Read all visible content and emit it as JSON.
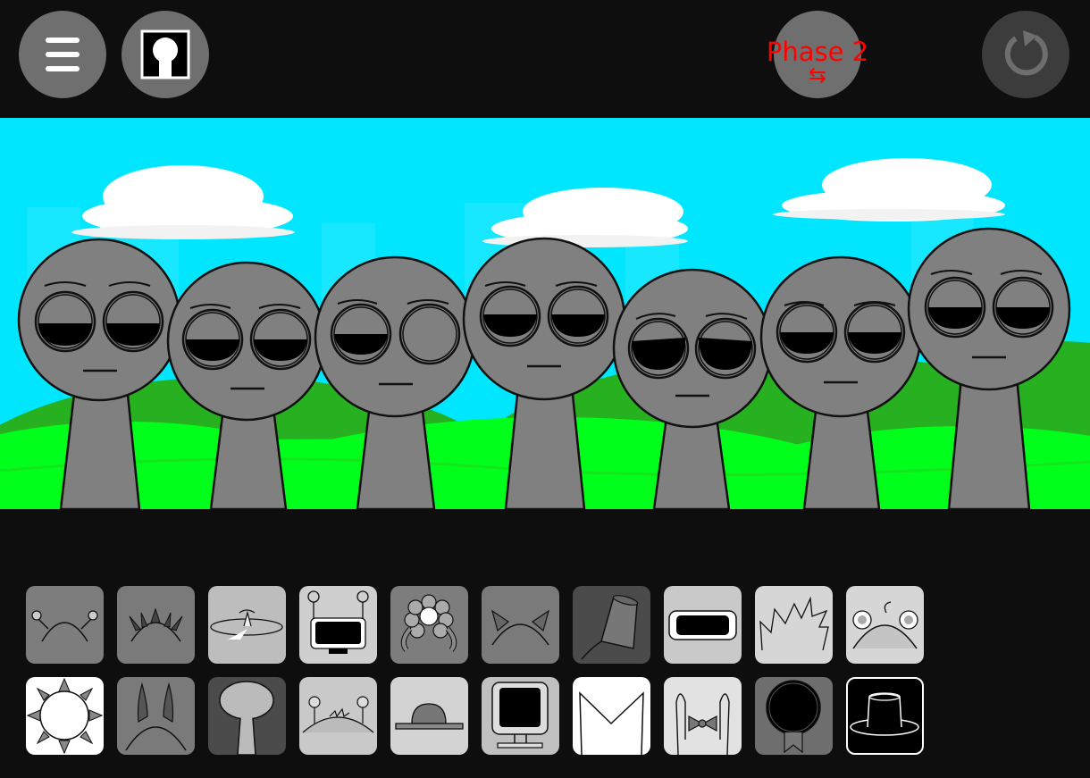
{
  "toolbar": {
    "menu_icon": "hamburger-menu-icon",
    "avatar_icon": "character-silhouette-icon",
    "phase_label": "Phase 2",
    "phase_arrows": "⇆",
    "reset_icon": "reset-icon"
  },
  "colors": {
    "sky": "#00e6ff",
    "grass": "#00ff1a",
    "hill": "#27b01f",
    "character": "#808080",
    "phase_text": "#ff0000"
  },
  "stage": {
    "character_count": 7,
    "characters": [
      {
        "slot": 1,
        "expression": "sleepy"
      },
      {
        "slot": 2,
        "expression": "sleepy"
      },
      {
        "slot": 3,
        "expression": "winking"
      },
      {
        "slot": 4,
        "expression": "sleepy"
      },
      {
        "slot": 5,
        "expression": "droopy"
      },
      {
        "slot": 6,
        "expression": "sleepy"
      },
      {
        "slot": 7,
        "expression": "sleepy"
      }
    ]
  },
  "tray": {
    "row1": [
      "antenna-balls-icon",
      "spikes-icon",
      "propeller-icon",
      "tv-head-icon",
      "flower-icon",
      "cat-ears-icon",
      "bucket-hat-icon",
      "visor-icon",
      "spiky-hair-icon",
      "bear-ears-icon"
    ],
    "row2": [
      "sun-icon",
      "horns-icon",
      "tree-icon",
      "antenna-hair-icon",
      "bowler-hat-icon",
      "monitor-icon",
      "envelope-icon",
      "bow-tie-icon",
      "medal-icon",
      "top-hat-icon"
    ]
  }
}
